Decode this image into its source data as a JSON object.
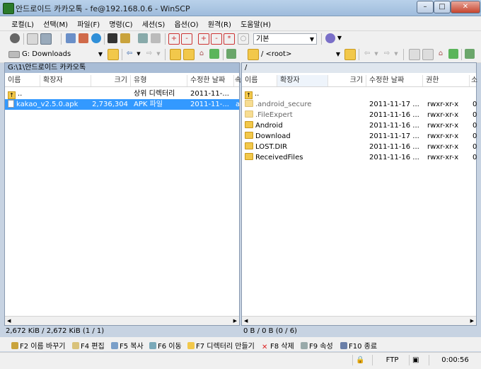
{
  "window": {
    "title": "안드로이드 카카오톡 - fe@192.168.0.6 - WinSCP",
    "controls": [
      "–",
      "□",
      "✕"
    ]
  },
  "menu": [
    "로컬(L)",
    "선택(M)",
    "파일(F)",
    "명령(C)",
    "세션(S)",
    "옵션(O)",
    "원격(R)",
    "도움말(H)"
  ],
  "toolbar": {
    "transfer_setting": "기본"
  },
  "local": {
    "drive_select": "G: Downloads",
    "path": "G:\\1\\안드로이드 카카오톡",
    "columns": [
      "이름",
      "확장자",
      "크기",
      "유형",
      "수정한 날짜",
      "속"
    ],
    "rows": [
      {
        "name": "..",
        "ext": "",
        "size": "",
        "type": "상위 디렉터리",
        "modified": "2011-11-...",
        "attr": ""
      },
      {
        "name": "kakao_v2.5.0.apk",
        "ext": "",
        "size": "2,736,304",
        "type": "APK 파일",
        "modified": "2011-11-...",
        "attr": "a"
      }
    ],
    "status": "2,672 KiB / 2,672 KiB (1 / 1)"
  },
  "remote": {
    "dir_select": "/ <root>",
    "path": "/",
    "columns": [
      "이름",
      "확장자",
      "크기",
      "수정한 날짜",
      "권한",
      "소"
    ],
    "rows": [
      {
        "name": "..",
        "modified": "",
        "rights": "",
        "owner": ""
      },
      {
        "name": ".android_secure",
        "modified": "2011-11-17 ...",
        "rights": "rwxr-xr-x",
        "owner": "0"
      },
      {
        "name": ".FileExpert",
        "modified": "2011-11-16 ...",
        "rights": "rwxr-xr-x",
        "owner": "0"
      },
      {
        "name": "Android",
        "modified": "2011-11-16 ...",
        "rights": "rwxr-xr-x",
        "owner": "0"
      },
      {
        "name": "Download",
        "modified": "2011-11-17 ...",
        "rights": "rwxr-xr-x",
        "owner": "0"
      },
      {
        "name": "LOST.DIR",
        "modified": "2011-11-16 ...",
        "rights": "rwxr-xr-x",
        "owner": "0"
      },
      {
        "name": "ReceivedFiles",
        "modified": "2011-11-16 ...",
        "rights": "rwxr-xr-x",
        "owner": "0"
      }
    ],
    "status": "0 B / 0 B (0 / 6)"
  },
  "fkeys": [
    "F2 이름 바꾸기",
    "F4 편집",
    "F5 복사",
    "F6 이동",
    "F7 디렉터리 만들기",
    "F8 삭제",
    "F9 속성",
    "F10 종료"
  ],
  "statusbar": {
    "protocol": "FTP",
    "elapsed": "0:00:56"
  },
  "colors": {
    "selection": "#3399ff",
    "title_gradient_top": "#b9d1ea",
    "folder": "#f2c84b"
  }
}
